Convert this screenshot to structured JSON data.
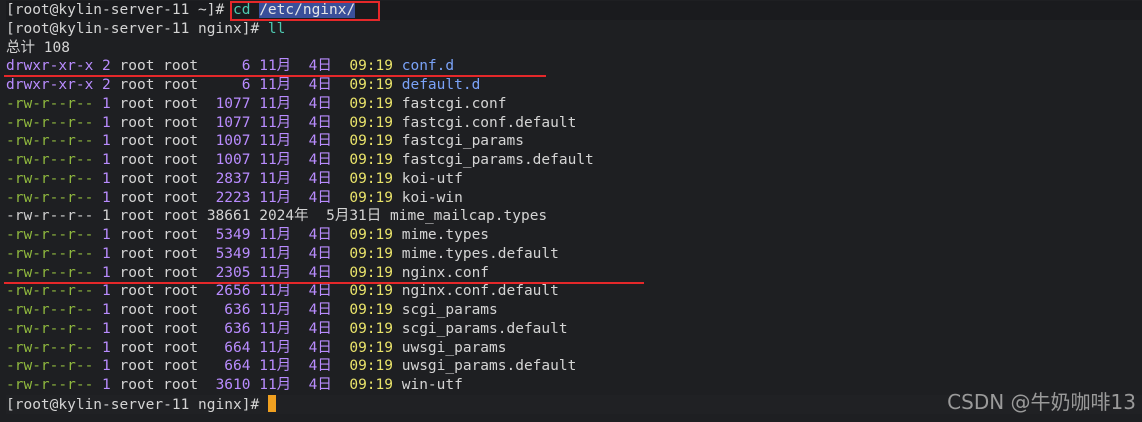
{
  "prompt_home": "[root@kylin-server-11 ~]",
  "prompt_nginx": "[root@kylin-server-11 nginx]",
  "hash": "#",
  "cmd1_name": "cd",
  "cmd1_arg": "/etc/nginx/",
  "cmd2": "ll",
  "total": "总计 108",
  "rows": [
    {
      "perm": "drwxr-xr-x",
      "links": "2",
      "owner": "root",
      "group": "root",
      "size": "   6",
      "date": "11月  4日",
      "time": "09:19",
      "name": "conf.d",
      "kind": "dir"
    },
    {
      "perm": "drwxr-xr-x",
      "links": "2",
      "owner": "root",
      "group": "root",
      "size": "   6",
      "date": "11月  4日",
      "time": "09:19",
      "name": "default.d",
      "kind": "dir"
    },
    {
      "perm": "-rw-r--r--",
      "links": "1",
      "owner": "root",
      "group": "root",
      "size": "1077",
      "date": "11月  4日",
      "time": "09:19",
      "name": "fastcgi.conf",
      "kind": "file"
    },
    {
      "perm": "-rw-r--r--",
      "links": "1",
      "owner": "root",
      "group": "root",
      "size": "1077",
      "date": "11月  4日",
      "time": "09:19",
      "name": "fastcgi.conf.default",
      "kind": "file"
    },
    {
      "perm": "-rw-r--r--",
      "links": "1",
      "owner": "root",
      "group": "root",
      "size": "1007",
      "date": "11月  4日",
      "time": "09:19",
      "name": "fastcgi_params",
      "kind": "file"
    },
    {
      "perm": "-rw-r--r--",
      "links": "1",
      "owner": "root",
      "group": "root",
      "size": "1007",
      "date": "11月  4日",
      "time": "09:19",
      "name": "fastcgi_params.default",
      "kind": "file"
    },
    {
      "perm": "-rw-r--r--",
      "links": "1",
      "owner": "root",
      "group": "root",
      "size": "2837",
      "date": "11月  4日",
      "time": "09:19",
      "name": "koi-utf",
      "kind": "file"
    },
    {
      "perm": "-rw-r--r--",
      "links": "1",
      "owner": "root",
      "group": "root",
      "size": "2223",
      "date": "11月  4日",
      "time": "09:19",
      "name": "koi-win",
      "kind": "file"
    },
    {
      "perm": "-rw-r--r--",
      "links": "1",
      "owner": "root",
      "group": "root",
      "size": "38661",
      "date": "2024年  5月31日",
      "time": "",
      "name": "mime_mailcap.types",
      "kind": "plain"
    },
    {
      "perm": "-rw-r--r--",
      "links": "1",
      "owner": "root",
      "group": "root",
      "size": "5349",
      "date": "11月  4日",
      "time": "09:19",
      "name": "mime.types",
      "kind": "file"
    },
    {
      "perm": "-rw-r--r--",
      "links": "1",
      "owner": "root",
      "group": "root",
      "size": "5349",
      "date": "11月  4日",
      "time": "09:19",
      "name": "mime.types.default",
      "kind": "file"
    },
    {
      "perm": "-rw-r--r--",
      "links": "1",
      "owner": "root",
      "group": "root",
      "size": "2305",
      "date": "11月  4日",
      "time": "09:19",
      "name": "nginx.conf",
      "kind": "file"
    },
    {
      "perm": "-rw-r--r--",
      "links": "1",
      "owner": "root",
      "group": "root",
      "size": "2656",
      "date": "11月  4日",
      "time": "09:19",
      "name": "nginx.conf.default",
      "kind": "file"
    },
    {
      "perm": "-rw-r--r--",
      "links": "1",
      "owner": "root",
      "group": "root",
      "size": " 636",
      "date": "11月  4日",
      "time": "09:19",
      "name": "scgi_params",
      "kind": "file"
    },
    {
      "perm": "-rw-r--r--",
      "links": "1",
      "owner": "root",
      "group": "root",
      "size": " 636",
      "date": "11月  4日",
      "time": "09:19",
      "name": "scgi_params.default",
      "kind": "file"
    },
    {
      "perm": "-rw-r--r--",
      "links": "1",
      "owner": "root",
      "group": "root",
      "size": " 664",
      "date": "11月  4日",
      "time": "09:19",
      "name": "uwsgi_params",
      "kind": "file"
    },
    {
      "perm": "-rw-r--r--",
      "links": "1",
      "owner": "root",
      "group": "root",
      "size": " 664",
      "date": "11月  4日",
      "time": "09:19",
      "name": "uwsgi_params.default",
      "kind": "file"
    },
    {
      "perm": "-rw-r--r--",
      "links": "1",
      "owner": "root",
      "group": "root",
      "size": "3610",
      "date": "11月  4日",
      "time": "09:19",
      "name": "win-utf",
      "kind": "file"
    }
  ],
  "watermark": "CSDN @牛奶咖啡13",
  "colors": {
    "background": "#1e1f22",
    "highlight_red": "#e5282a",
    "directory": "#7aa2f7",
    "time": "#e9e36a",
    "numbers": "#b98cff",
    "permissions_file": "#8fb83e",
    "cursor": "#f0a020"
  }
}
